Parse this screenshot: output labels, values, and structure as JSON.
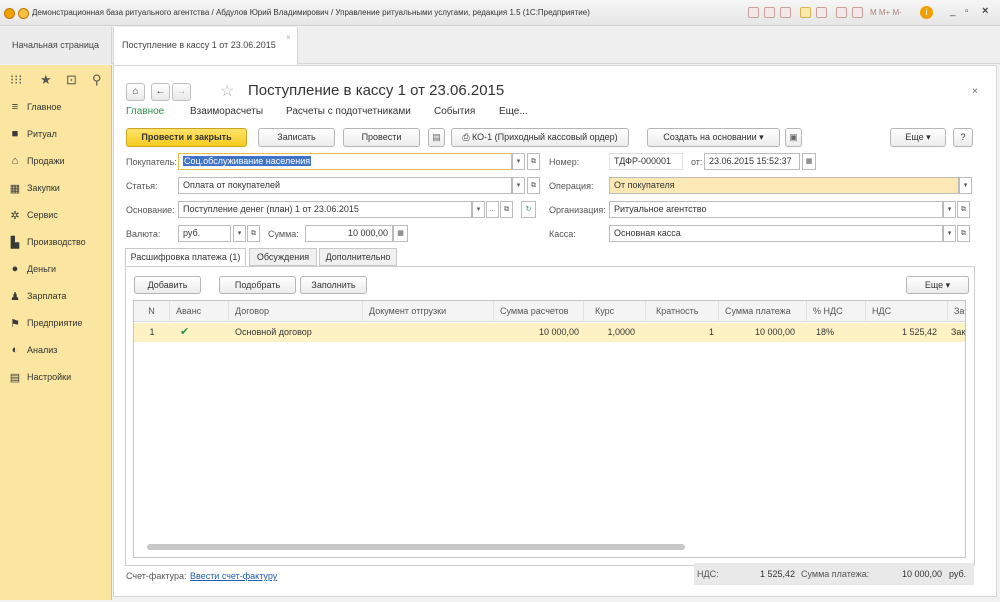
{
  "window": {
    "title": "Демонстрационная база ритуального агентства / Абдулов Юрий Владимирович / Управление ритуальными услугами, редакция 1.5 (1С:Предприятие)",
    "controls": [
      "_",
      "▫",
      "×"
    ],
    "toolbar_text": "M  M+  M-"
  },
  "tabs": {
    "home": "Начальная страница",
    "document": "Поступление в кассу 1 от 23.06.2015",
    "close": "×"
  },
  "sidebar": {
    "items": [
      {
        "label": "Главное",
        "icon": "≡"
      },
      {
        "label": "Ритуал",
        "icon": "■"
      },
      {
        "label": "Продажи",
        "icon": "⌂"
      },
      {
        "label": "Закупки",
        "icon": "▦"
      },
      {
        "label": "Сервис",
        "icon": "✲"
      },
      {
        "label": "Производство",
        "icon": "▙"
      },
      {
        "label": "Деньги",
        "icon": "●"
      },
      {
        "label": "Зарплата",
        "icon": "♟"
      },
      {
        "label": "Предприятие",
        "icon": "⚑"
      },
      {
        "label": "Анализ",
        "icon": "◐"
      },
      {
        "label": "Настройки",
        "icon": "▤"
      }
    ]
  },
  "doc": {
    "title": "Поступление в кассу 1 от 23.06.2015",
    "sections": [
      "Главное",
      "Взаиморасчеты",
      "Расчеты с подотчетниками",
      "События",
      "Еще..."
    ],
    "buttons": {
      "post_close": "Провести и закрыть",
      "save": "Записать",
      "post": "Провести",
      "ko1": "КО-1 (Приходный кассовый ордер)",
      "create_based": "Создать на основании",
      "more": "Еще",
      "help": "?"
    },
    "fields": {
      "buyer_label": "Покупатель:",
      "buyer_value": "Соц.обслуживание населения",
      "number_label": "Номер:",
      "number_value": "ТДФР-000001",
      "date_label": "от:",
      "date_value": "23.06.2015 15:52:37",
      "article_label": "Статья:",
      "article_value": "Оплата от покупателей",
      "operation_label": "Операция:",
      "operation_value": "От покупателя",
      "basis_label": "Основание:",
      "basis_value": "Поступление денег (план) 1 от 23.06.2015",
      "org_label": "Организация:",
      "org_value": "Ритуальное агентство",
      "currency_label": "Валюта:",
      "currency_value": "руб.",
      "sum_label": "Сумма:",
      "sum_value": "10 000,00",
      "cash_label": "Касса:",
      "cash_value": "Основная касса"
    },
    "form_tabs": [
      "Расшифровка платежа (1)",
      "Обсуждения",
      "Дополнительно"
    ],
    "table_buttons": {
      "add": "Добавить",
      "select": "Подобрать",
      "fill": "Заполнить",
      "more": "Еще"
    },
    "columns": [
      "N",
      "Аванс",
      "Договор",
      "Документ отгрузки",
      "Сумма расчетов",
      "Курс",
      "Кратность",
      "Сумма платежа",
      "% НДС",
      "НДС",
      "Заказ"
    ],
    "row": {
      "n": "1",
      "advance": "✔",
      "contract": "Основной договор",
      "shipment": "",
      "settlement_sum": "10 000,00",
      "rate": "1,0000",
      "multiplicity": "1",
      "payment_sum": "10 000,00",
      "vat_pct": "18%",
      "vat": "1 525,42",
      "order": "Заказ"
    },
    "footer": {
      "invoice_label": "Счет-фактура:",
      "invoice_link": "Ввести счет-фактуру",
      "vat_label": "НДС:",
      "vat_value": "1 525,42",
      "payment_label": "Сумма платежа:",
      "payment_value": "10 000,00",
      "currency": "руб."
    }
  }
}
